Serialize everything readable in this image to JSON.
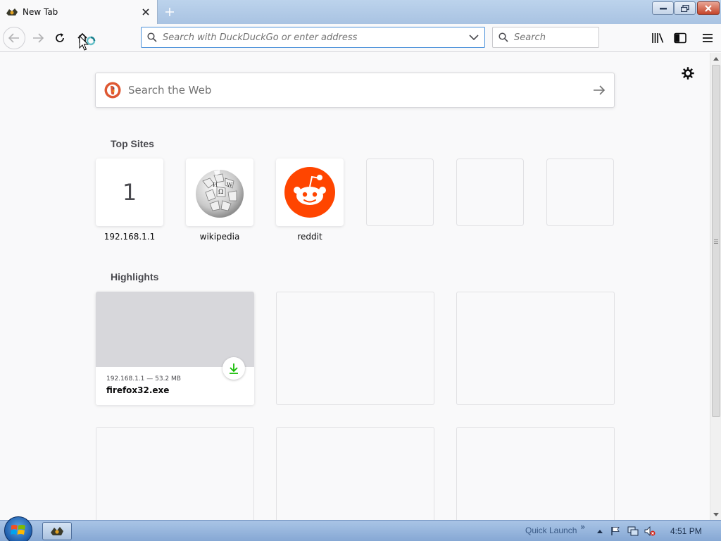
{
  "tab": {
    "title": "New Tab"
  },
  "urlbar": {
    "placeholder": "Search with DuckDuckGo or enter address"
  },
  "searchbar": {
    "placeholder": "Search"
  },
  "content": {
    "web_search": {
      "placeholder": "Search the Web"
    },
    "top_sites": {
      "title": "Top Sites",
      "items": [
        {
          "label": "192.168.1.1",
          "tile_text": "1",
          "icon": "letter-tile"
        },
        {
          "label": "wikipedia",
          "icon": "wikipedia-globe-icon"
        },
        {
          "label": "reddit",
          "icon": "reddit-alien-icon"
        },
        {
          "label": "",
          "icon": "empty"
        },
        {
          "label": "",
          "icon": "empty"
        },
        {
          "label": "",
          "icon": "empty"
        }
      ]
    },
    "highlights": {
      "title": "Highlights",
      "items": [
        {
          "meta": "192.168.1.1 — 53.2 MB",
          "title": "firefox32.exe",
          "icon": "download-icon"
        }
      ]
    }
  },
  "taskbar": {
    "quick_launch": "Quick Launch",
    "chevron": "»",
    "clock": "4:51 PM"
  },
  "colors": {
    "accent": "#0a84ff",
    "reddit": "#ff4500",
    "download_green": "#12bc00",
    "taskbar": "#9dbbe2"
  }
}
